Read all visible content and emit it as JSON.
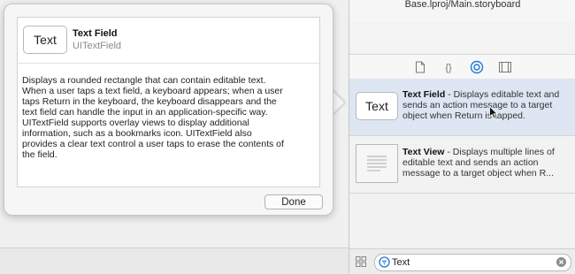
{
  "window": {
    "file_path": "Base.lproj/Main.storyboard"
  },
  "quick_help": {
    "thumbnail_text": "Text",
    "title": "Text Field",
    "class_name": "UITextField",
    "description": "Displays a rounded rectangle that can contain editable text.\nWhen a user taps a text field, a keyboard appears; when a user\ntaps Return in the keyboard, the keyboard disappears and the\ntext field can handle the input in an application-specific way.\nUITextField supports overlay views to display additional\ninformation, such as a bookmarks icon. UITextField also\nprovides a clear text control a user taps to erase the contents of\nthe field.",
    "done_label": "Done"
  },
  "canvas_toolbar": {
    "icons": [
      "align-icon",
      "pin-icon",
      "resolve-icon"
    ]
  },
  "library": {
    "tabs": [
      {
        "icon": "file-template-icon",
        "selected": false
      },
      {
        "icon": "code-snippet-icon",
        "selected": false
      },
      {
        "icon": "object-library-icon",
        "selected": true
      },
      {
        "icon": "media-library-icon",
        "selected": false
      }
    ],
    "items": [
      {
        "thumbnail_text": "Text",
        "name": "Text Field",
        "description": " - Displays editable text and sends an action message to a target object when Return is tapped.",
        "selected": true
      },
      {
        "thumbnail_text": "",
        "name": "Text View",
        "description": " - Displays multiple lines of editable text and sends an action message to a target object when R...",
        "selected": false
      }
    ],
    "filter": {
      "value": "Text"
    }
  },
  "colors": {
    "selection": "#dde6f2",
    "accent": "#1f7ad8",
    "popover_bg": "#f6f6f6"
  }
}
